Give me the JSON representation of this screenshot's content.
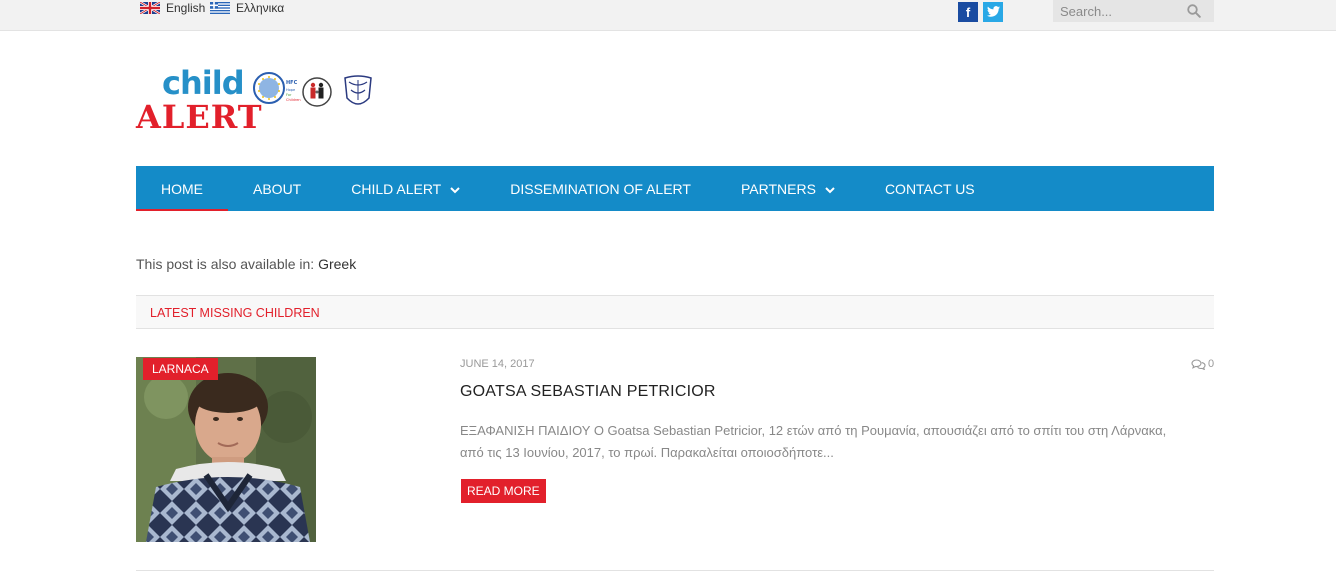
{
  "topbar": {
    "languages": [
      {
        "label": "English",
        "flag": "uk-flag-icon"
      },
      {
        "label": "Ελληνικα",
        "flag": "greece-flag-icon"
      }
    ],
    "social": [
      {
        "label": "f",
        "icon": "facebook-icon",
        "color": "#1a4ca1"
      },
      {
        "label": "t",
        "icon": "twitter-icon",
        "color": "#29a8e6"
      }
    ],
    "search": {
      "placeholder": "Search..."
    }
  },
  "logo": {
    "line1": "child",
    "line2": "ALERT",
    "emblem_text": [
      "HFC",
      "Hope",
      "For",
      "Children"
    ]
  },
  "nav": {
    "items": [
      {
        "label": "HOME",
        "active": true,
        "dropdown": false
      },
      {
        "label": "ABOUT",
        "active": false,
        "dropdown": false
      },
      {
        "label": "CHILD ALERT",
        "active": false,
        "dropdown": true
      },
      {
        "label": "DISSEMINATION OF ALERT",
        "active": false,
        "dropdown": false
      },
      {
        "label": "PARTNERS",
        "active": false,
        "dropdown": true
      },
      {
        "label": "CONTACT US",
        "active": false,
        "dropdown": false
      }
    ]
  },
  "content": {
    "availability_text": "This post is also available in: ",
    "availability_link": "Greek",
    "section_title": "LATEST MISSING CHILDREN",
    "post": {
      "category": "LARNACA",
      "date": "JUNE 14, 2017",
      "comments": "0",
      "title": "GOATSA SEBASTIAN PETRICIOR",
      "excerpt_line1": "ΕΞΑΦΑΝΙΣΗ ΠΑΙΔΙΟΥ Ο Goatsa Sebastian Petricior, 12 ετών από τη Ρουμανία, απουσιάζει από το σπίτι του στη Λάρνακα,",
      "excerpt_line2": "από τις 13 Ιουνίου, 2017, το πρωί. Παρακαλείται οποιοσδήποτε...",
      "read_more": "READ MORE"
    }
  },
  "colors": {
    "nav_bg": "#148bc8",
    "accent_red": "#e2202b",
    "logo_blue": "#2690c8"
  }
}
